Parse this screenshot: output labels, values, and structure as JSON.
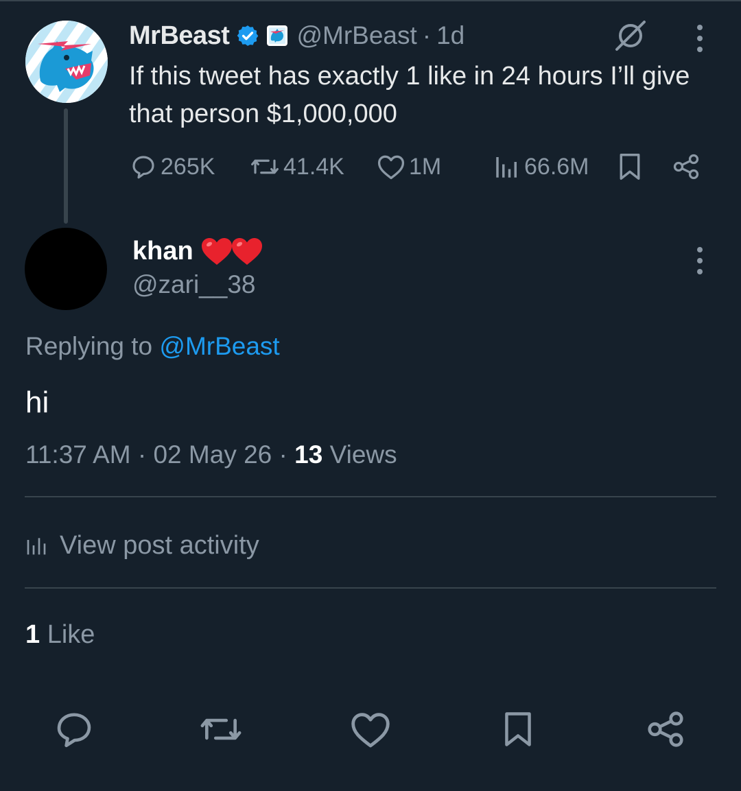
{
  "parent_tweet": {
    "author_name": "MrBeast",
    "handle": "@MrBeast",
    "separator": "·",
    "time_ago": "1d",
    "text": "If this tweet has exactly 1 like in 24 hours I’ll give that person $1,000,000",
    "avatar_icon": "panther-logo-icon",
    "stats": {
      "replies": "265K",
      "reposts": "41.4K",
      "likes": "1M",
      "views": "66.6M"
    }
  },
  "reply_tweet": {
    "author_name": "khan",
    "author_emoji": "❤️❤️",
    "handle": "@zari__38",
    "replying_prefix": "Replying to",
    "replying_to": "@MrBeast",
    "text": "hi",
    "time": "11:37 AM",
    "separator": "·",
    "date": "02 May 26",
    "views_count": "13",
    "views_label": "Views",
    "view_activity_label": "View post activity",
    "likes_count": "1",
    "likes_label": "Like"
  },
  "colors": {
    "background": "#15202b",
    "text_primary": "#e7e9ea",
    "text_secondary": "#8b98a5",
    "accent": "#1d9bf0",
    "divider": "#38444d",
    "heart": "#e0245e"
  }
}
